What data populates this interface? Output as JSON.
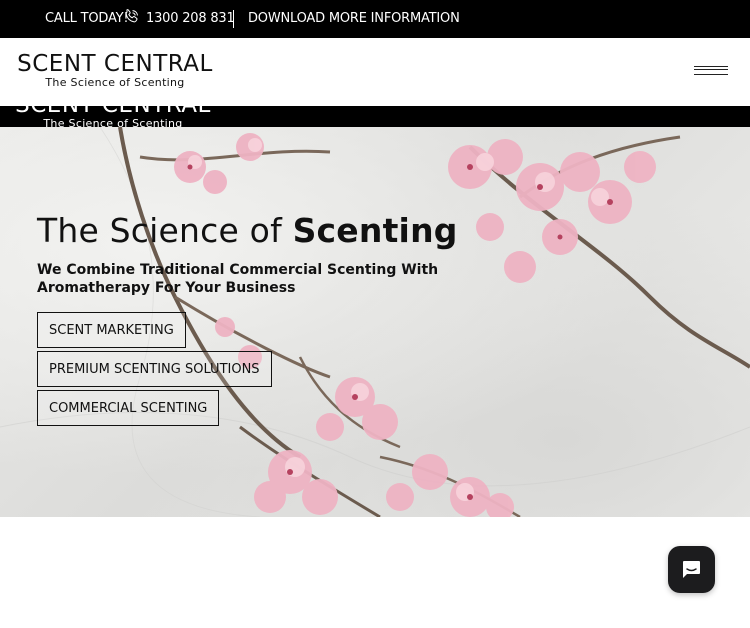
{
  "topbar": {
    "call_label": "CALL TODAY!",
    "phone_icon": "phone-icon",
    "phone": "1300 208 831",
    "download_link": "DOWNLOAD MORE INFORMATION"
  },
  "header": {
    "logo_name": "SCENT CENTRAL",
    "logo_tagline": "The Science of Scenting",
    "menu_icon": "hamburger-menu-icon"
  },
  "strip": {
    "logo_name": "SCENT CENTRAL",
    "logo_tagline": "The Science of Scenting"
  },
  "hero": {
    "title_regular": "The Science of ",
    "title_bold": "Scenting",
    "subtitle": "We Combine Traditional Commercial Scenting With Aromatherapy For Your Business",
    "buttons": [
      {
        "label": "SCENT MARKETING"
      },
      {
        "label": "PREMIUM SCENTING SOLUTIONS"
      },
      {
        "label": "COMMERCIAL SCENTING"
      }
    ],
    "background_image": "cherry-blossom-branches-on-marble"
  },
  "chat": {
    "icon": "chat-bubble-icon"
  },
  "colors": {
    "topbar_bg": "#000000",
    "text": "#111111",
    "blossom": "#e8a9b8",
    "chat_bg": "#1c1c1e"
  }
}
